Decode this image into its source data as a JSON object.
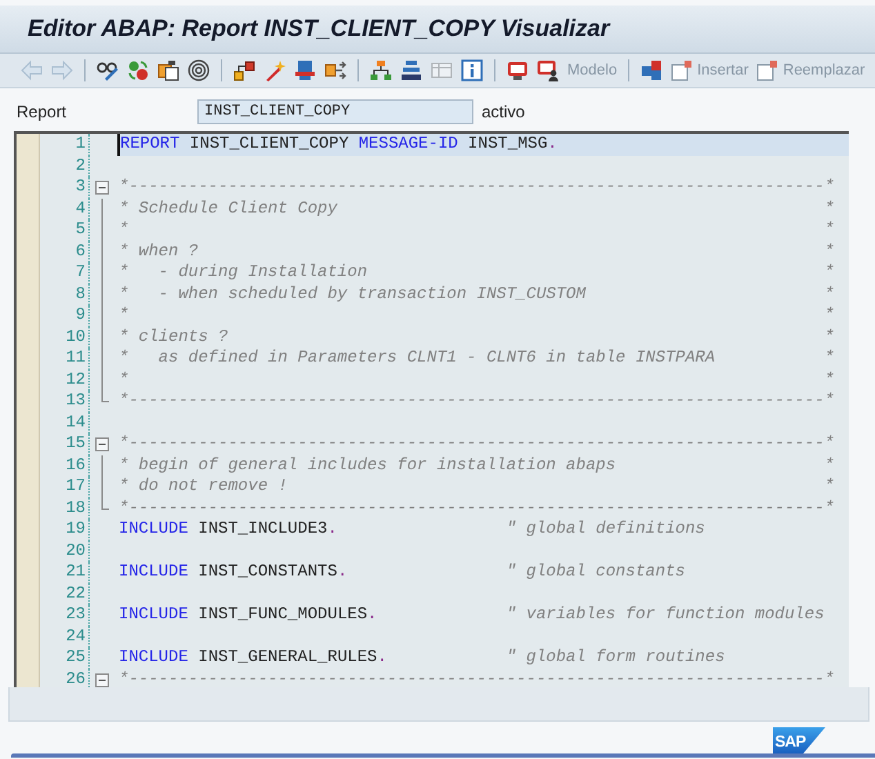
{
  "window": {
    "title": "Editor ABAP: Report INST_CLIENT_COPY Visualizar"
  },
  "toolbar": [
    {
      "kind": "icon",
      "disabled": true
    },
    {
      "kind": "icon",
      "disabled": true
    },
    {
      "kind": "separator"
    },
    {
      "kind": "icon",
      "disabled": false
    },
    {
      "kind": "icon",
      "disabled": false
    },
    {
      "kind": "icon",
      "disabled": false
    },
    {
      "kind": "icon",
      "disabled": false
    },
    {
      "kind": "separator"
    },
    {
      "kind": "icon",
      "disabled": false
    },
    {
      "kind": "icon",
      "disabled": false
    },
    {
      "kind": "icon",
      "disabled": false
    },
    {
      "kind": "icon",
      "disabled": false
    },
    {
      "kind": "separator"
    },
    {
      "kind": "icon",
      "disabled": false
    },
    {
      "kind": "icon",
      "disabled": false
    },
    {
      "kind": "icon",
      "disabled": true
    },
    {
      "kind": "icon",
      "disabled": false
    },
    {
      "kind": "separator"
    },
    {
      "kind": "icon",
      "disabled": false
    },
    {
      "kind": "icon",
      "disabled": false
    },
    {
      "kind": "text",
      "label": "Modelo",
      "disabled": true
    },
    {
      "kind": "separator"
    },
    {
      "kind": "icon",
      "disabled": false
    },
    {
      "kind": "labeled",
      "label": "Insertar",
      "disabled": true
    },
    {
      "kind": "labeled",
      "label": "Reemplazar",
      "disabled": true
    }
  ],
  "program_field": {
    "label": "Report",
    "value": "INST_CLIENT_COPY",
    "status": "activo"
  },
  "editor": {
    "lines": [
      {
        "number": "1",
        "kind": "code",
        "current": true,
        "tokens": [
          {
            "kind": "keyword",
            "text": "REPORT"
          },
          {
            "kind": "plain",
            "text": " INST_CLIENT_COPY "
          },
          {
            "kind": "keyword",
            "text": "MESSAGE-ID"
          },
          {
            "kind": "plain",
            "text": " INST_MSG"
          },
          {
            "kind": "punct",
            "text": "."
          }
        ]
      },
      {
        "number": "2",
        "kind": "code",
        "current": false
      },
      {
        "number": "3",
        "kind": "block_start",
        "current": false,
        "tokens": [
          {
            "kind": "comment",
            "text": "*----------------------------------------------------------------------"
          }
        ],
        "end": "*"
      },
      {
        "number": "4",
        "kind": "block_inner",
        "current": false,
        "tokens": [
          {
            "kind": "comment",
            "text": "* Schedule Client Copy"
          }
        ],
        "end": "*"
      },
      {
        "number": "5",
        "kind": "block_inner",
        "current": false,
        "tokens": [
          {
            "kind": "comment",
            "text": "*"
          }
        ],
        "end": "*"
      },
      {
        "number": "6",
        "kind": "block_inner",
        "current": false,
        "tokens": [
          {
            "kind": "comment",
            "text": "* when ?"
          }
        ],
        "end": "*"
      },
      {
        "number": "7",
        "kind": "block_inner",
        "current": false,
        "tokens": [
          {
            "kind": "comment",
            "text": "*   - during Installation"
          }
        ],
        "end": "*"
      },
      {
        "number": "8",
        "kind": "block_inner",
        "current": false,
        "tokens": [
          {
            "kind": "comment",
            "text": "*   - when scheduled by transaction INST_CUSTOM"
          }
        ],
        "end": "*"
      },
      {
        "number": "9",
        "kind": "block_inner",
        "current": false,
        "tokens": [
          {
            "kind": "comment",
            "text": "*"
          }
        ],
        "end": "*"
      },
      {
        "number": "10",
        "kind": "block_inner",
        "current": false,
        "tokens": [
          {
            "kind": "comment",
            "text": "* clients ?"
          }
        ],
        "end": "*"
      },
      {
        "number": "11",
        "kind": "block_inner",
        "current": false,
        "tokens": [
          {
            "kind": "comment",
            "text": "*   as defined in Parameters CLNT1 - CLNT6 in table INSTPARA"
          }
        ],
        "end": "*"
      },
      {
        "number": "12",
        "kind": "block_inner",
        "current": false,
        "tokens": [
          {
            "kind": "comment",
            "text": "*"
          }
        ],
        "end": "*"
      },
      {
        "number": "13",
        "kind": "block_end",
        "current": false,
        "tokens": [
          {
            "kind": "comment",
            "text": "*----------------------------------------------------------------------"
          }
        ],
        "end": "*"
      },
      {
        "number": "14",
        "kind": "code",
        "current": false
      },
      {
        "number": "15",
        "kind": "block_start",
        "current": false,
        "tokens": [
          {
            "kind": "comment",
            "text": "*----------------------------------------------------------------------"
          }
        ],
        "end": "*"
      },
      {
        "number": "16",
        "kind": "block_inner",
        "current": false,
        "tokens": [
          {
            "kind": "comment",
            "text": "* begin of general includes for installation abaps"
          }
        ],
        "end": "*"
      },
      {
        "number": "17",
        "kind": "block_inner",
        "current": false,
        "tokens": [
          {
            "kind": "comment",
            "text": "* do not remove !"
          }
        ],
        "end": "*"
      },
      {
        "number": "18",
        "kind": "block_end",
        "current": false,
        "tokens": [
          {
            "kind": "comment",
            "text": "*----------------------------------------------------------------------"
          }
        ],
        "end": "*"
      },
      {
        "number": "19",
        "kind": "code",
        "current": false,
        "tokens": [
          {
            "kind": "keyword",
            "text": "INCLUDE"
          },
          {
            "kind": "plain",
            "text": " INST_INCLUDE3"
          },
          {
            "kind": "punct",
            "text": "."
          }
        ],
        "trailing": "\" global definitions"
      },
      {
        "number": "20",
        "kind": "code",
        "current": false
      },
      {
        "number": "21",
        "kind": "code",
        "current": false,
        "tokens": [
          {
            "kind": "keyword",
            "text": "INCLUDE"
          },
          {
            "kind": "plain",
            "text": " INST_CONSTANTS"
          },
          {
            "kind": "punct",
            "text": "."
          }
        ],
        "trailing": "\" global constants"
      },
      {
        "number": "22",
        "kind": "code",
        "current": false
      },
      {
        "number": "23",
        "kind": "code",
        "current": false,
        "tokens": [
          {
            "kind": "keyword",
            "text": "INCLUDE"
          },
          {
            "kind": "plain",
            "text": " INST_FUNC_MODULES"
          },
          {
            "kind": "punct",
            "text": "."
          }
        ],
        "trailing": "\" variables for function modules"
      },
      {
        "number": "24",
        "kind": "code",
        "current": false
      },
      {
        "number": "25",
        "kind": "code",
        "current": false,
        "tokens": [
          {
            "kind": "keyword",
            "text": "INCLUDE"
          },
          {
            "kind": "plain",
            "text": " INST_GENERAL_RULES"
          },
          {
            "kind": "punct",
            "text": "."
          }
        ],
        "trailing": "\" global form routines"
      },
      {
        "number": "26",
        "kind": "block_start",
        "current": false,
        "tokens": [
          {
            "kind": "comment",
            "text": "*----------------------------------------------------------------------"
          }
        ],
        "end": "*"
      }
    ]
  },
  "logo": {
    "text": "SAP"
  }
}
